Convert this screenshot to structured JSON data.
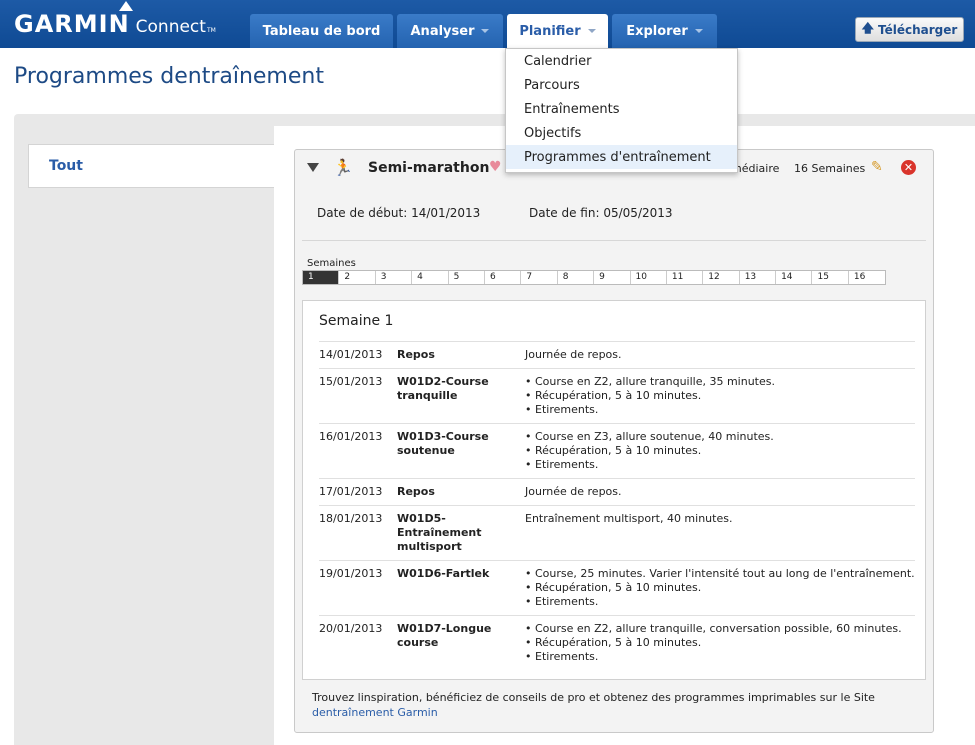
{
  "header": {
    "logo_brand": "GARMIN",
    "logo_product": "Connect",
    "logo_tm": "TM",
    "nav": [
      {
        "label": "Tableau de bord"
      },
      {
        "label": "Analyser"
      },
      {
        "label": "Planifier"
      },
      {
        "label": "Explorer"
      }
    ],
    "upload_label": "Télécharger"
  },
  "dropdown": {
    "items": [
      {
        "label": "Calendrier"
      },
      {
        "label": "Parcours"
      },
      {
        "label": "Entraînements"
      },
      {
        "label": "Objectifs"
      },
      {
        "label": "Programmes d'entraînement"
      }
    ]
  },
  "page": {
    "title": "Programmes dentraînement",
    "left_tab": "Tout"
  },
  "plan": {
    "name": "Semi-marathon",
    "level": "Intermédiaire",
    "level_visible": "médiaire",
    "weeks_count": "16 Semaines",
    "start_label": "Date de début:",
    "start_date": "14/01/2013",
    "end_label": "Date de fin:",
    "end_date": "05/05/2013",
    "weeks_label": "Semaines",
    "weeks": [
      "1",
      "2",
      "3",
      "4",
      "5",
      "6",
      "7",
      "8",
      "9",
      "10",
      "11",
      "12",
      "13",
      "14",
      "15",
      "16"
    ],
    "current_week_title": "Semaine 1",
    "days": [
      {
        "date": "14/01/2013",
        "title": "Repos",
        "desc": [
          "Journée de repos."
        ],
        "bullets": false
      },
      {
        "date": "15/01/2013",
        "title": "W01D2-Course tranquille",
        "desc": [
          "Course en Z2, allure tranquille, 35 minutes.",
          "Récupération, 5 à 10 minutes.",
          "Etirements."
        ],
        "bullets": true
      },
      {
        "date": "16/01/2013",
        "title": "W01D3-Course soutenue",
        "desc": [
          "Course en Z3, allure soutenue, 40 minutes.",
          "Récupération, 5 à 10 minutes.",
          "Etirements."
        ],
        "bullets": true
      },
      {
        "date": "17/01/2013",
        "title": "Repos",
        "desc": [
          "Journée de repos."
        ],
        "bullets": false
      },
      {
        "date": "18/01/2013",
        "title": "W01D5-Entraînement multisport",
        "desc": [
          "Entraînement multisport, 40 minutes."
        ],
        "bullets": false
      },
      {
        "date": "19/01/2013",
        "title": "W01D6-Fartlek",
        "desc": [
          "Course, 25 minutes. Varier l'intensité tout au long de l'entraînement.",
          "Récupération, 5 à 10 minutes.",
          "Etirements."
        ],
        "bullets": true
      },
      {
        "date": "20/01/2013",
        "title": "W01D7-Longue course",
        "desc": [
          "Course en Z2, allure tranquille, conversation possible, 60 minutes.",
          "Récupération, 5 à 10 minutes.",
          "Etirements."
        ],
        "bullets": true
      }
    ]
  },
  "footer": {
    "text": "Trouvez linspiration, bénéficiez de conseils de pro et obtenez des programmes imprimables sur le Site",
    "link": "dentraînement Garmin"
  },
  "colors": {
    "header_blue": "#0f4a94",
    "nav_blue": "#2463b0",
    "title_blue": "#1d4a85",
    "link_blue": "#2a5da8",
    "delete_red": "#d9342b"
  }
}
